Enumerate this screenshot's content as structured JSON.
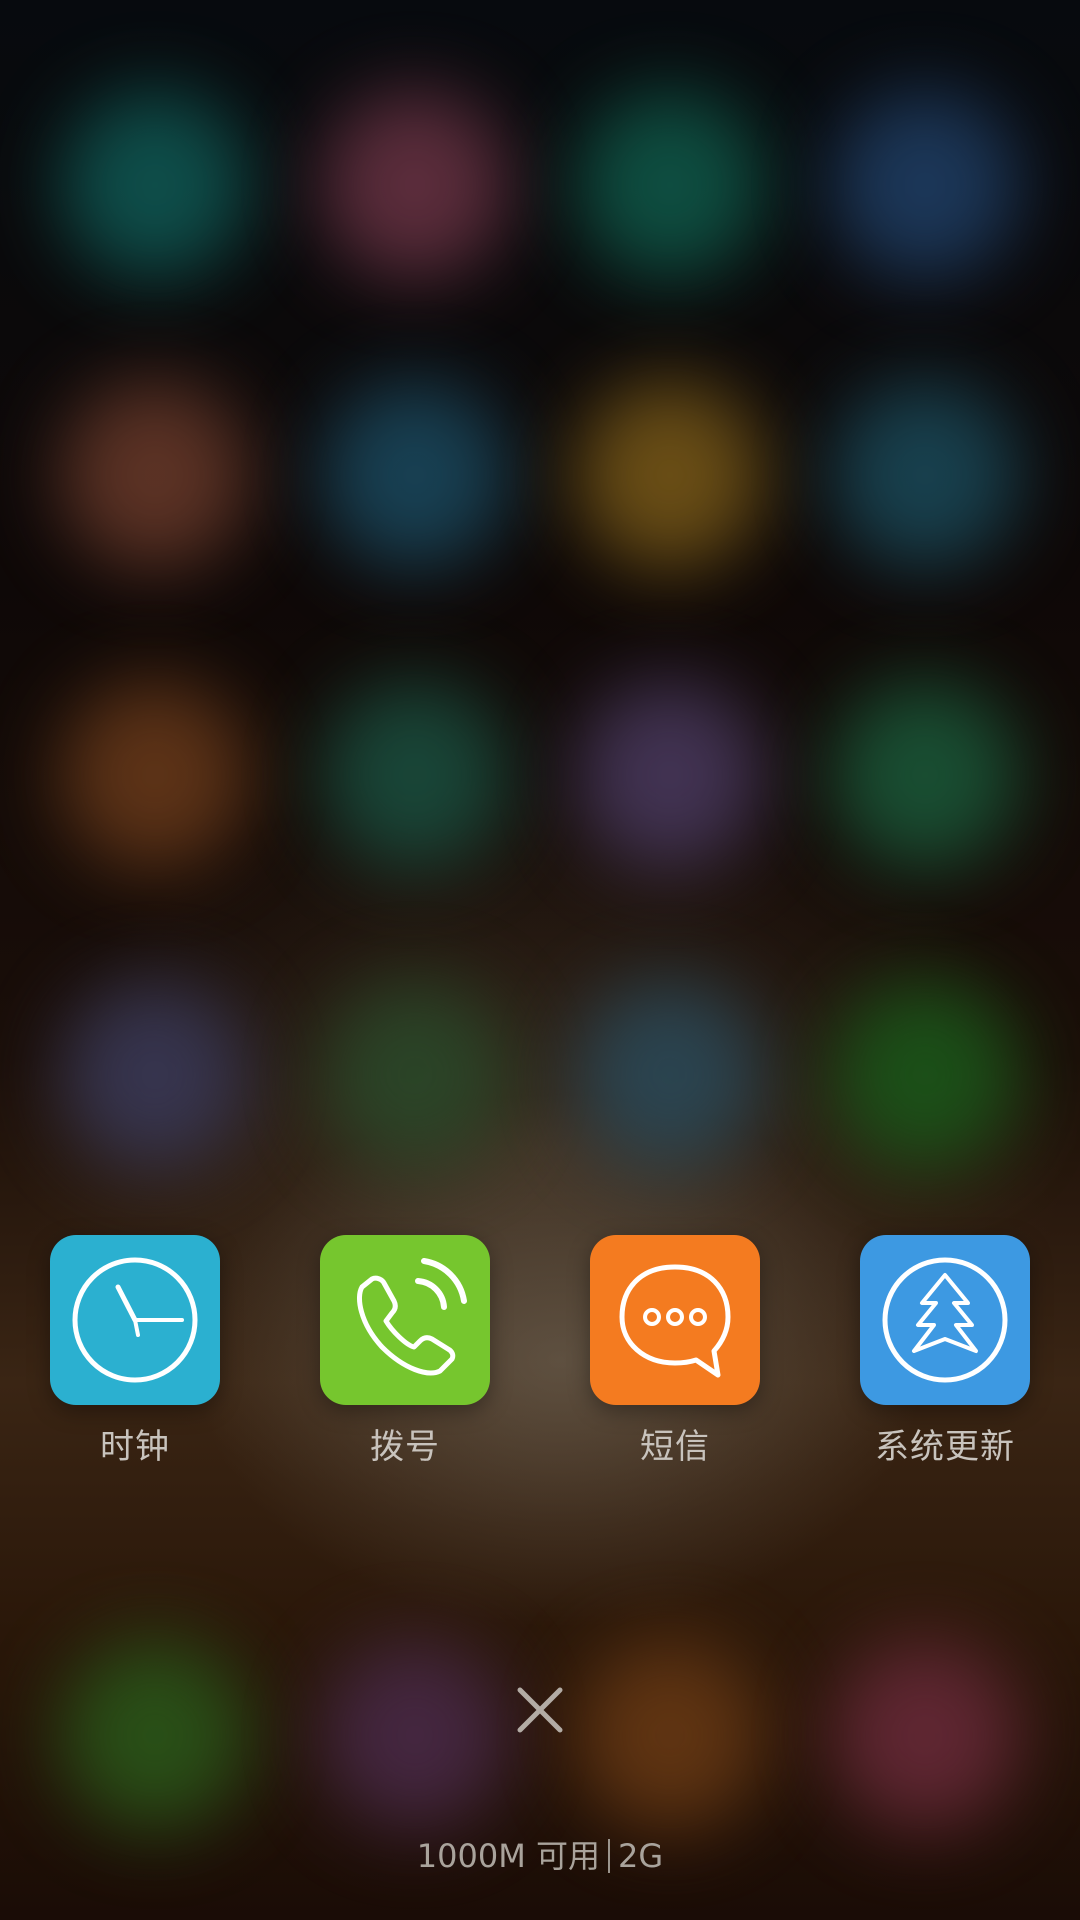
{
  "dock": {
    "apps": [
      {
        "label": "时钟",
        "icon": "clock-icon",
        "color": "#2bb0d0"
      },
      {
        "label": "拨号",
        "icon": "phone-icon",
        "color": "#76c62e"
      },
      {
        "label": "短信",
        "icon": "message-icon",
        "color": "#f47b20"
      },
      {
        "label": "系统更新",
        "icon": "update-icon",
        "color": "#3d99e2"
      }
    ]
  },
  "recents": {
    "close_icon": "close-icon",
    "memory_available": "1000M 可用",
    "memory_total": "2G"
  },
  "colors": {
    "label_text": "#c8c3bd",
    "memory_text": "#a9a39c"
  }
}
